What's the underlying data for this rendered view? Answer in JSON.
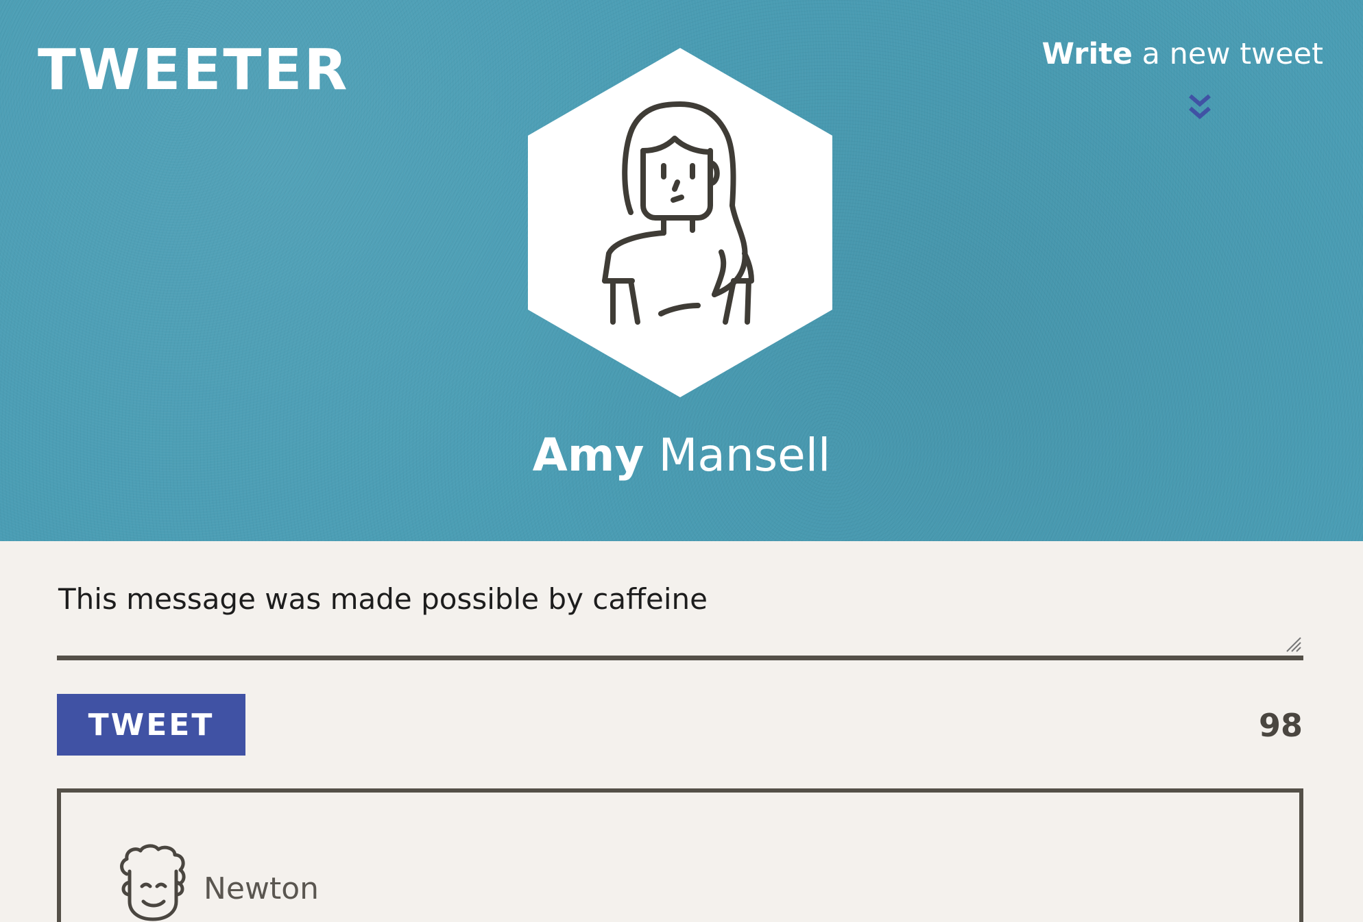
{
  "header": {
    "logo": "TWEETER",
    "write_bold": "Write",
    "write_rest": "a new tweet",
    "chevron_icon": "double-chevron-down-icon"
  },
  "profile": {
    "first_name": "Amy",
    "last_name": "Mansell",
    "avatar_icon": "woman-avatar-icon"
  },
  "composer": {
    "text": "This message was made possible by caffeine",
    "button_label": "TWEET",
    "char_count": "98"
  },
  "feed": [
    {
      "author": "Newton",
      "avatar_icon": "curly-hair-man-avatar-icon"
    }
  ],
  "colors": {
    "header_bg": "#4a9db4",
    "page_bg": "#f4f1ed",
    "button_bg": "#4052a4",
    "border": "#545048"
  }
}
